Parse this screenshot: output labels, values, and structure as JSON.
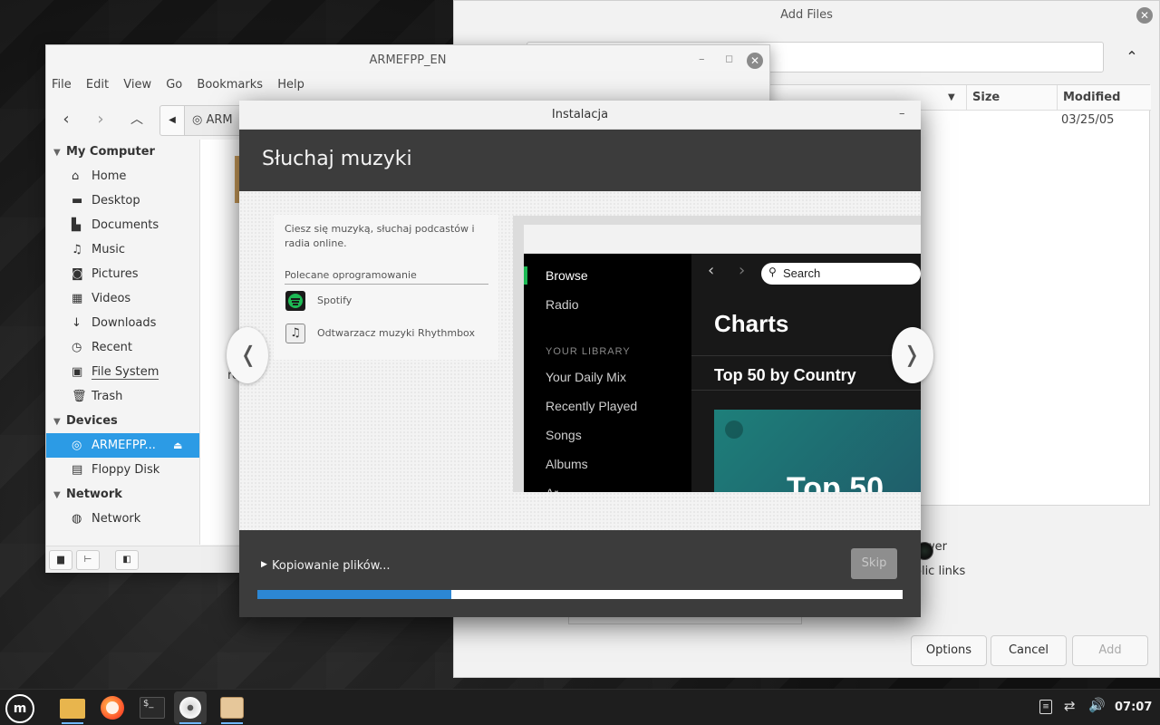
{
  "addfiles": {
    "title": "Add Files",
    "columns": {
      "size": "Size",
      "modified": "Modified"
    },
    "row_modified": "03/25/05",
    "partial_option_1": "ower",
    "partial_option_2": "olic links",
    "buttons": {
      "options": "Options",
      "cancel": "Cancel",
      "add": "Add"
    }
  },
  "filemanager": {
    "title": "ARMEFPP_EN",
    "menu": [
      "File",
      "Edit",
      "View",
      "Go",
      "Bookmarks",
      "Help"
    ],
    "location_partial": "ARM",
    "content_partial": "rea",
    "sidebar": {
      "my_computer": "My Computer",
      "items": [
        "Home",
        "Desktop",
        "Documents",
        "Music",
        "Pictures",
        "Videos",
        "Downloads",
        "Recent",
        "File System",
        "Trash"
      ],
      "devices": "Devices",
      "device_items": [
        "ARMEFPP...",
        "Floppy Disk"
      ],
      "network": "Network",
      "network_items": [
        "Network"
      ]
    }
  },
  "installer": {
    "title": "Instalacja",
    "minimize": "–",
    "heading": "Słuchaj muzyki",
    "description": "Ciesz się muzyką, słuchaj podcastów i radia online.",
    "recommended_label": "Polecane oprogramowanie",
    "apps": [
      "Spotify",
      "Odtwarzacz muzyki Rhythmbox"
    ],
    "status": "Kopiowanie plików...",
    "skip": "Skip",
    "progress": 0.3,
    "prev_arrow": "❬",
    "next_arrow": "❭"
  },
  "spotify": {
    "nav": [
      "Browse",
      "Radio"
    ],
    "library_label": "YOUR LIBRARY",
    "library": [
      "Your Daily Mix",
      "Recently Played",
      "Songs",
      "Albums",
      "Ar"
    ],
    "search_placeholder": "Search",
    "charts": "Charts",
    "top50_country": "Top 50 by Country",
    "tile_text": "Top 50"
  },
  "taskbar": {
    "clock": "07:07"
  }
}
